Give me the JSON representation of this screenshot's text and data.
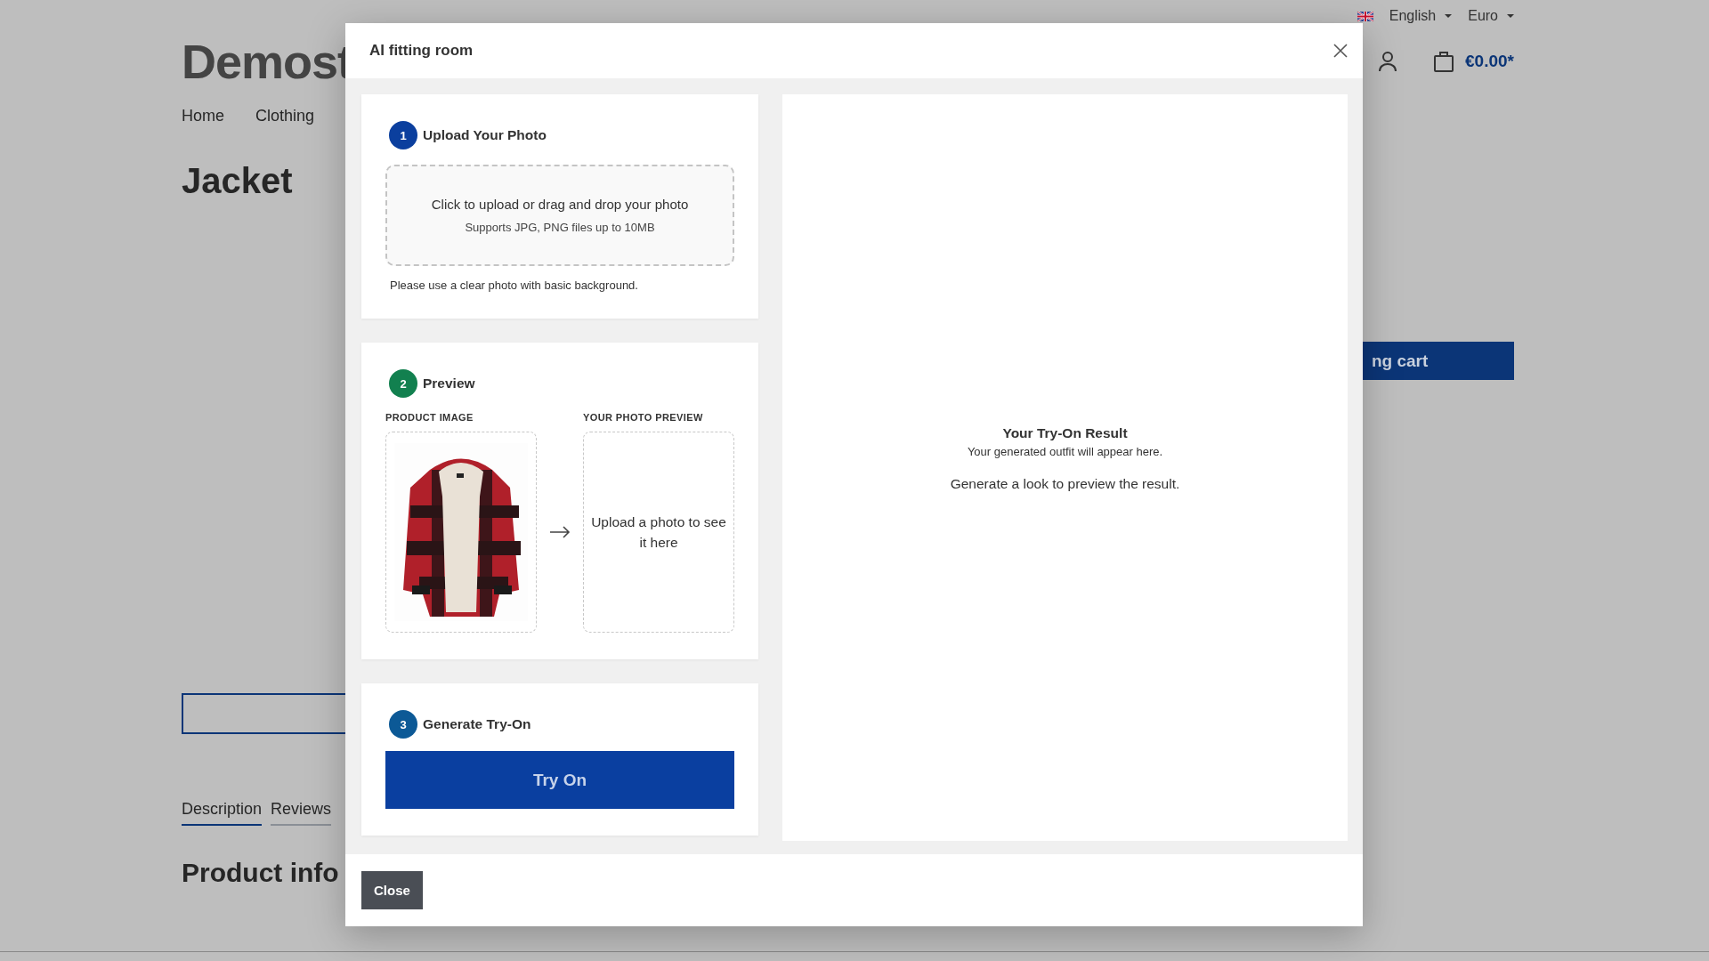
{
  "page": {
    "language": "English",
    "currency": "Euro",
    "logo": "Demost",
    "cart_total": "€0.00*",
    "nav": [
      "Home",
      "Clothing"
    ],
    "title": "Jacket",
    "cart_button": "ng cart",
    "tabs": [
      {
        "label": "Description",
        "selected": true
      },
      {
        "label": "Reviews",
        "selected": false
      }
    ],
    "section_heading": "Product info"
  },
  "modal": {
    "title": "AI fitting room",
    "steps": [
      {
        "kind": "upload",
        "number": "1",
        "title": "Upload Your Photo",
        "color": "#0b3f9e",
        "dropzone_text": "Click to upload or drag and drop your photo",
        "dropzone_hint": "Supports JPG, PNG files up to 10MB",
        "note": "Please use a clear photo with basic background."
      },
      {
        "kind": "preview",
        "number": "2",
        "title": "Preview",
        "color": "#12804f",
        "product_label": "PRODUCT IMAGE",
        "photo_label": "YOUR PHOTO PREVIEW",
        "photo_placeholder": "Upload a photo to see it here"
      },
      {
        "kind": "generate",
        "number": "3",
        "title": "Generate Try-On",
        "color": "#0c5996",
        "button": "Try On"
      }
    ],
    "result": {
      "title": "Your Try-On Result",
      "subtitle": "Your generated outfit will appear here.",
      "hint": "Generate a look to preview the result."
    },
    "close_button": "Close"
  }
}
